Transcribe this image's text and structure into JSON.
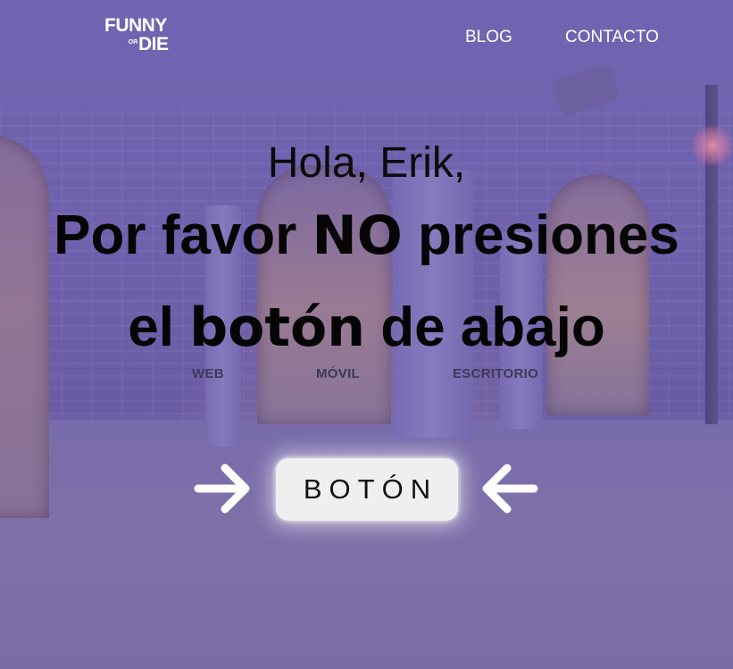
{
  "header": {
    "logo": {
      "line1": "FUNNY",
      "line2": "OR",
      "line3": "DIE"
    },
    "nav": [
      {
        "label": "BLOG"
      },
      {
        "label": "CONTACTO"
      }
    ]
  },
  "hero": {
    "greeting": "Hola, Erik,",
    "line1_pre": "Por favor ",
    "line1_emph": "NO",
    "line1_post": " presiones",
    "line2_pre": "el ",
    "line2_emph": "botón",
    "line2_post": " de abajo",
    "platforms": [
      "WEB",
      "MÓVIL",
      "ESCRITORIO"
    ]
  },
  "cta": {
    "button_label": "BOTÓN",
    "left_icon": "arrow-right-icon",
    "right_icon": "arrow-left-icon"
  },
  "colors": {
    "overlay": "#6e62a8",
    "text_dark": "#050505",
    "nav_text": "#ffffff",
    "button_bg": "#efefef"
  }
}
